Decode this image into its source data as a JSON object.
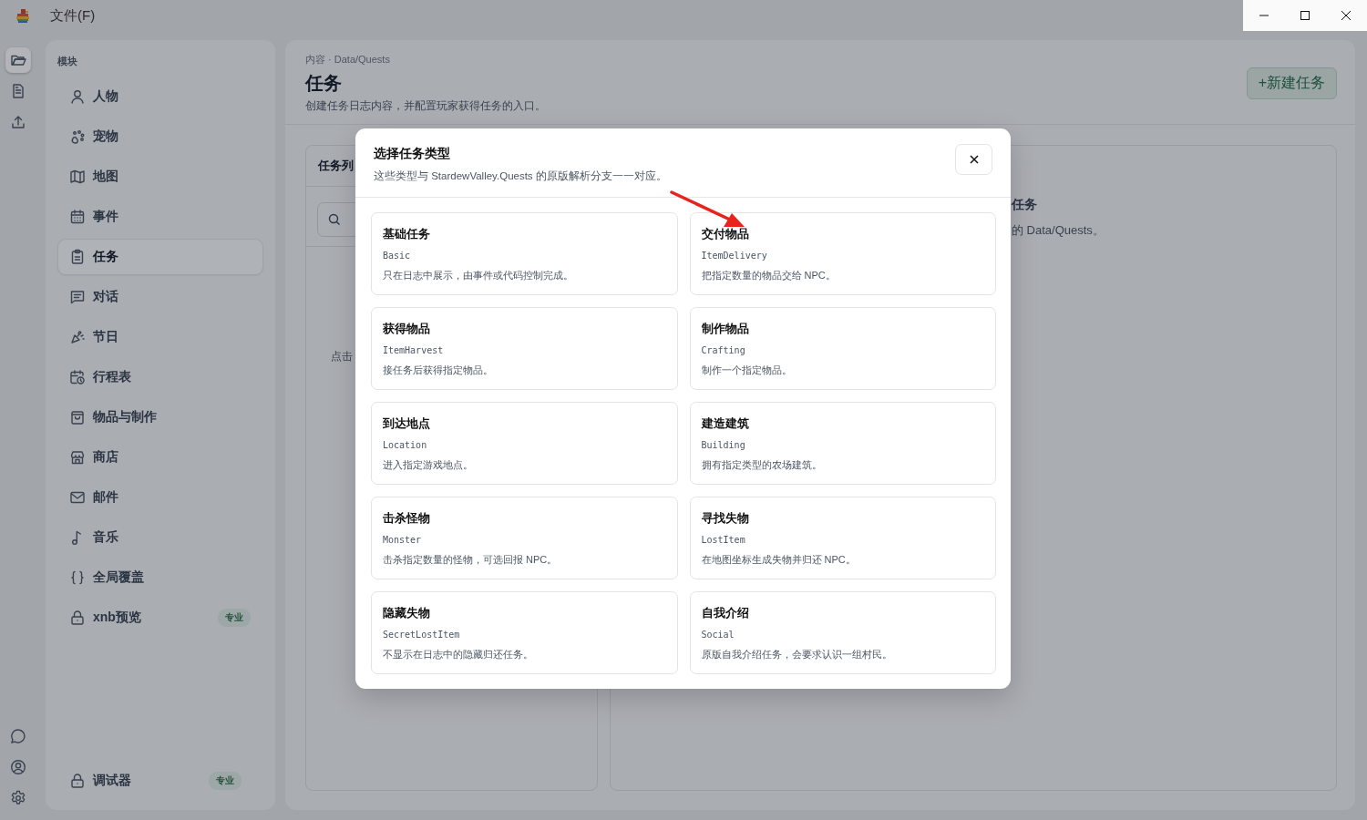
{
  "menu": [
    {
      "label": "文件(F)"
    }
  ],
  "rail": [
    {
      "selected": true
    },
    {
      "selected": false
    },
    {
      "selected": false
    }
  ],
  "sidebar": {
    "heading": "模块",
    "items": [
      {
        "label": "人物",
        "selected": false
      },
      {
        "label": "宠物",
        "selected": false
      },
      {
        "label": "地图",
        "selected": false
      },
      {
        "label": "事件",
        "selected": false
      },
      {
        "label": "任务",
        "selected": true
      },
      {
        "label": "对话",
        "selected": false
      },
      {
        "label": "节日",
        "selected": false
      },
      {
        "label": "行程表",
        "selected": false
      },
      {
        "label": "物品与制作",
        "selected": false
      },
      {
        "label": "商店",
        "selected": false
      },
      {
        "label": "邮件",
        "selected": false
      },
      {
        "label": "音乐",
        "selected": false
      },
      {
        "label": "全局覆盖",
        "selected": false
      },
      {
        "label": "xnb预览",
        "selected": false,
        "badge": "专业"
      }
    ],
    "footer_item": {
      "label": "调试器",
      "badge": "专业"
    }
  },
  "page": {
    "breadcrumb": "内容 · Data/Quests",
    "title": "任务",
    "description": "创建任务日志内容，并配置玩家获得任务的入口。",
    "new_button": "+新建任务"
  },
  "list_card": {
    "title": "任务列",
    "hint": "点击"
  },
  "detail_card": {
    "title": "任务",
    "text": "的 Data/Quests。"
  },
  "dialog": {
    "title": "选择任务类型",
    "subtitle": "这些类型与 StardewValley.Quests 的原版解析分支一一对应。",
    "types": [
      {
        "name": "基础任务",
        "code": "Basic",
        "description": "只在日志中展示，由事件或代码控制完成。"
      },
      {
        "name": "交付物品",
        "code": "ItemDelivery",
        "description": "把指定数量的物品交给 NPC。"
      },
      {
        "name": "获得物品",
        "code": "ItemHarvest",
        "description": "接任务后获得指定物品。"
      },
      {
        "name": "制作物品",
        "code": "Crafting",
        "description": "制作一个指定物品。"
      },
      {
        "name": "到达地点",
        "code": "Location",
        "description": "进入指定游戏地点。"
      },
      {
        "name": "建造建筑",
        "code": "Building",
        "description": "拥有指定类型的农场建筑。"
      },
      {
        "name": "击杀怪物",
        "code": "Monster",
        "description": "击杀指定数量的怪物，可选回报 NPC。"
      },
      {
        "name": "寻找失物",
        "code": "LostItem",
        "description": "在地图坐标生成失物并归还 NPC。"
      },
      {
        "name": "隐藏失物",
        "code": "SecretLostItem",
        "description": "不显示在日志中的隐藏归还任务。"
      },
      {
        "name": "自我介绍",
        "code": "Social",
        "description": "原版自我介绍任务，会要求认识一组村民。"
      }
    ]
  }
}
